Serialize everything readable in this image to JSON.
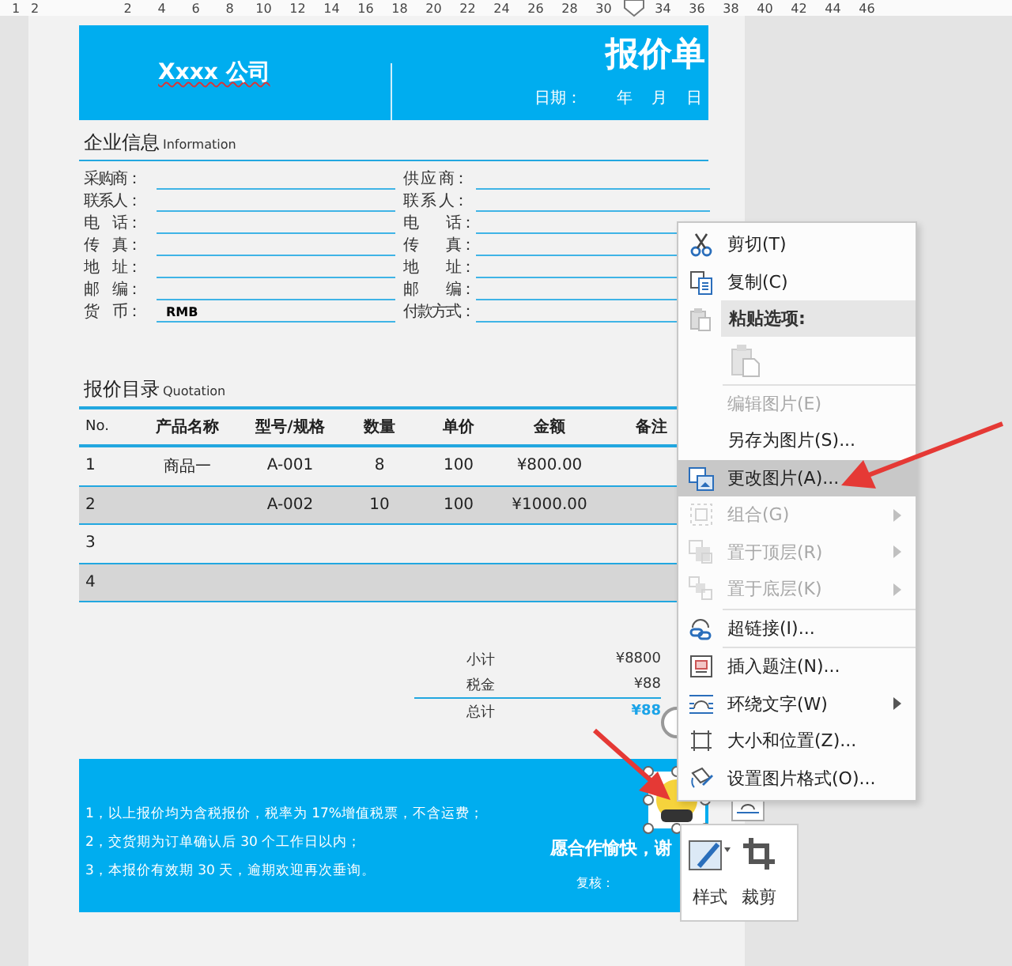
{
  "ruler": {
    "left_labels": [
      "1",
      "2"
    ],
    "labels": [
      "2",
      "4",
      "6",
      "8",
      "10",
      "12",
      "14",
      "16",
      "18",
      "20",
      "22",
      "24",
      "26",
      "28",
      "30"
    ],
    "right_labels": [
      "34",
      "36",
      "38",
      "40",
      "42",
      "44",
      "46"
    ]
  },
  "header": {
    "company": "Xxxx 公司",
    "title": "报价单",
    "date_label": "日期：",
    "date_parts": [
      "年",
      "月",
      "日"
    ]
  },
  "company_info": {
    "title": "企业信息",
    "subtitle": "Information",
    "rows": [
      {
        "left_label": "采购商：",
        "right_label": "供 应 商："
      },
      {
        "left_label": "联系人：",
        "right_label": "联 系 人："
      },
      {
        "left_label": "电　话：",
        "right_label": "电　　话："
      },
      {
        "left_label": "传　真：",
        "right_label": "传　　真："
      },
      {
        "left_label": "地　址：",
        "right_label": "地　　址："
      },
      {
        "left_label": "邮　编：",
        "right_label": "邮　　编："
      },
      {
        "left_label": "货　币：",
        "left_value": "RMB",
        "right_label": "付款方式："
      }
    ]
  },
  "quotation": {
    "title": "报价目录",
    "subtitle": "Quotation",
    "columns": [
      "No.",
      "产品名称",
      "型号/规格",
      "数量",
      "单价",
      "金额",
      "备注"
    ],
    "rows": [
      {
        "no": "1",
        "name": "商品一",
        "model": "A-001",
        "qty": "8",
        "price": "100",
        "amount": "¥800.00",
        "shaded": false
      },
      {
        "no": "2",
        "model": "A-002",
        "qty": "10",
        "price": "100",
        "amount": "¥1000.00",
        "shaded": true
      },
      {
        "no": "3",
        "shaded": false
      },
      {
        "no": "4",
        "shaded": true
      }
    ]
  },
  "totals": [
    {
      "label": "小计",
      "value": "¥8800",
      "highlight": false
    },
    {
      "label": "税金",
      "value": "¥88",
      "highlight": false
    },
    {
      "label": "总计",
      "value": "¥88",
      "highlight": true
    }
  ],
  "footer": {
    "notes": [
      "1，以上报价均为含税报价，税率为 17%增值税票，不含运费；",
      "2，交货期为订单确认后 30 个工作日以内；",
      "3，本报价有效期 30 天，逾期欢迎再次垂询。"
    ],
    "closing": "愿合作愉快，谢",
    "reviewer_label": "复核：",
    "image": {
      "kind": "picture"
    }
  },
  "context_menu": {
    "groups": [
      [
        {
          "kind": "item",
          "label": "剪切(T)",
          "disabled": false,
          "selected": false,
          "submenu": false
        },
        {
          "kind": "item",
          "label": "复制(C)",
          "disabled": false,
          "selected": false,
          "submenu": false
        },
        {
          "kind": "header",
          "label": "粘贴选项:"
        },
        {
          "kind": "paste",
          "disabled": true
        }
      ],
      [
        {
          "kind": "item",
          "label": "编辑图片(E)",
          "disabled": true,
          "selected": false,
          "submenu": false
        },
        {
          "kind": "item",
          "label": "另存为图片(S)...",
          "disabled": false,
          "selected": false,
          "submenu": false
        },
        {
          "kind": "item",
          "label": "更改图片(A)...",
          "disabled": false,
          "selected": true,
          "submenu": false
        },
        {
          "kind": "item",
          "label": "组合(G)",
          "disabled": true,
          "selected": false,
          "submenu": true
        },
        {
          "kind": "item",
          "label": "置于顶层(R)",
          "disabled": true,
          "selected": false,
          "submenu": true
        },
        {
          "kind": "item",
          "label": "置于底层(K)",
          "disabled": true,
          "selected": false,
          "submenu": true
        }
      ],
      [
        {
          "kind": "item",
          "label": "超链接(I)...",
          "disabled": false,
          "selected": false,
          "submenu": false
        }
      ],
      [
        {
          "kind": "item",
          "label": "插入题注(N)...",
          "disabled": false,
          "selected": false,
          "submenu": false
        },
        {
          "kind": "item",
          "label": "环绕文字(W)",
          "disabled": false,
          "selected": false,
          "submenu": true
        },
        {
          "kind": "item",
          "label": "大小和位置(Z)...",
          "disabled": false,
          "selected": false,
          "submenu": false
        },
        {
          "kind": "item",
          "label": "设置图片格式(O)...",
          "disabled": false,
          "selected": false,
          "submenu": false
        }
      ]
    ]
  },
  "mini_toolbar": {
    "buttons": [
      {
        "label": "样式"
      },
      {
        "label": "裁剪"
      }
    ]
  }
}
